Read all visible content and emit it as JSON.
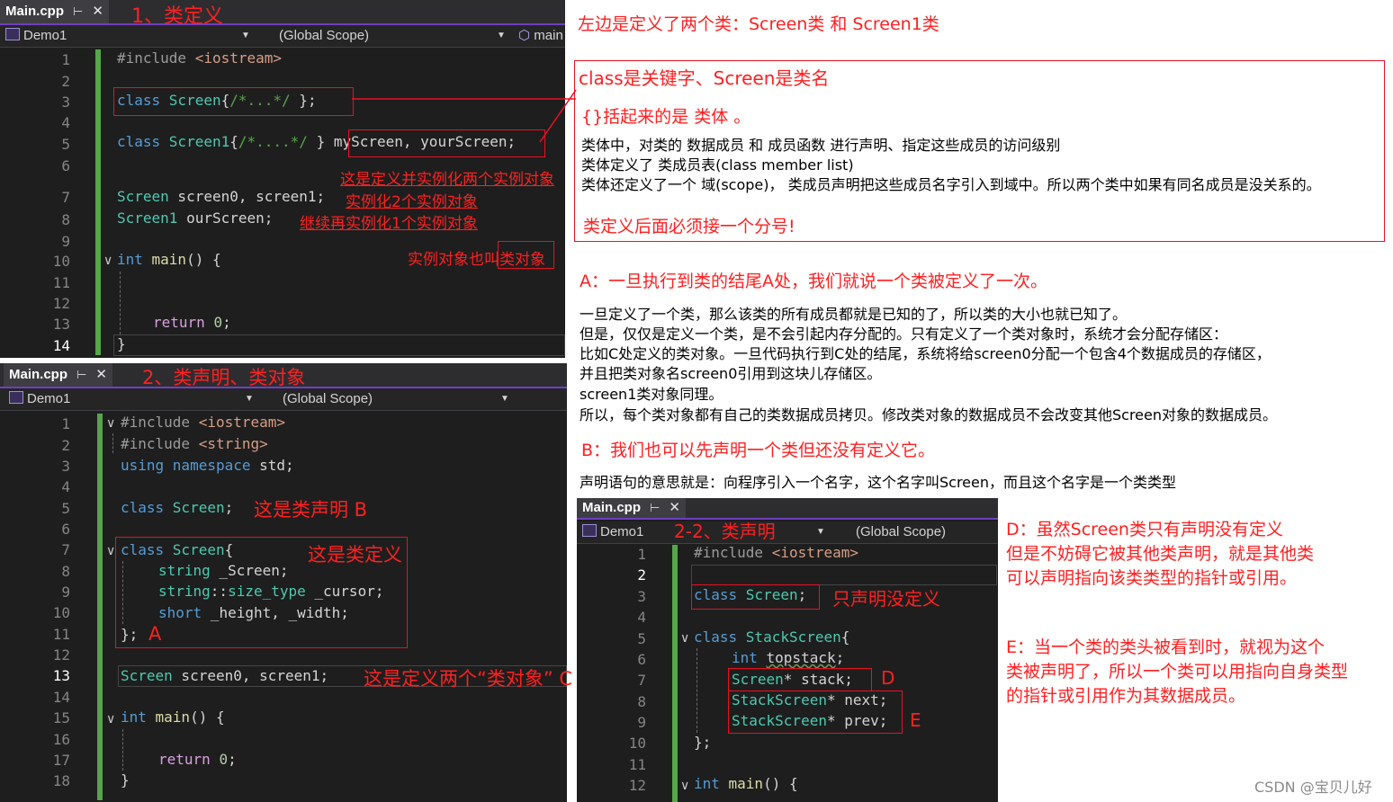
{
  "editor1": {
    "tab": "Main.cpp",
    "pin": "⊢",
    "close": "✕",
    "heading": "1、类定义",
    "project": "Demo1",
    "scope": "(Global Scope)",
    "member": "main",
    "lines": [
      "1",
      "2",
      "3",
      "4",
      "5",
      "6",
      "7",
      "8",
      "9",
      "10",
      "11",
      "12",
      "13",
      "14"
    ],
    "code": {
      "l1a": "#include ",
      "l1b": "<iostream>",
      "l3a": "class ",
      "l3b": "Screen",
      "l3c": "{",
      "l3d": "/*...*/",
      "l3e": " };",
      "l5a": "class ",
      "l5b": "Screen1",
      "l5c": "{",
      "l5d": "/*....*/",
      "l5e": " } ",
      "l5f": "myScreen, yourScreen",
      "l5g": ";",
      "l7a": "Screen",
      "l7b": " screen0, screen1;",
      "l8a": "Screen1",
      "l8b": " ourScreen;",
      "l10a": "int ",
      "l10b": "main",
      "l10c": "() {",
      "l13a": "return ",
      "l13b": "0",
      "l13c": ";",
      "l14": "}"
    },
    "notes": {
      "n5": "这是定义并实例化两个实例对象",
      "n7": "实例化2个实例对象",
      "n8": "继续再实例化1个实例对象",
      "n10": "实例对象也叫类对象"
    }
  },
  "editor2": {
    "tab": "Main.cpp",
    "pin": "⊢",
    "close": "✕",
    "heading": "2、类声明、类对象",
    "project": "Demo1",
    "scope": "(Global Scope)",
    "lines": [
      "1",
      "2",
      "3",
      "4",
      "5",
      "6",
      "7",
      "8",
      "9",
      "10",
      "11",
      "12",
      "13",
      "14",
      "15",
      "16",
      "17",
      "18"
    ],
    "code": {
      "l1a": "#include ",
      "l1b": "<iostream>",
      "l2a": "#include ",
      "l2b": "<string>",
      "l3a": "using namespace ",
      "l3b": "std;",
      "l5a": "class ",
      "l5b": "Screen",
      "l5c": ";",
      "l7a": "class ",
      "l7b": "Screen",
      "l7c": "{",
      "l8a": "string",
      "l8b": " _Screen;",
      "l9a": "string",
      "l9b": "::",
      "l9c": "size_type",
      "l9d": " _cursor;",
      "l10a": "short",
      "l10b": " _height, _width;",
      "l11": "};",
      "l13a": "Screen",
      "l13b": " screen0, screen1;",
      "l15a": "int ",
      "l15b": "main",
      "l15c": "() {",
      "l17a": "return ",
      "l17b": "0",
      "l17c": ";",
      "l18": "}"
    },
    "notes": {
      "n5": "这是类声明  B",
      "n7": "这是类定义",
      "n11": "A",
      "n13": "这是定义两个“类对象”  C"
    }
  },
  "editor3": {
    "tab": "Main.cpp",
    "pin": "⊢",
    "close": "✕",
    "heading": "2-2、类声明",
    "project": "Demo1",
    "scope": "(Global Scope)",
    "lines": [
      "1",
      "2",
      "3",
      "4",
      "5",
      "6",
      "7",
      "8",
      "9",
      "10",
      "11",
      "12"
    ],
    "code": {
      "l1a": "#include ",
      "l1b": "<iostream>",
      "l3a": "class ",
      "l3b": "Screen",
      "l3c": ";",
      "l5a": "class ",
      "l5b": "StackScreen",
      "l5c": "{",
      "l6a": "int ",
      "l6b": "topstack",
      "l6c": ";",
      "l7a": "Screen",
      "l7b": "* ",
      "l7c": "stack",
      "l7d": ";",
      "l8a": "StackScreen",
      "l8b": "* ",
      "l8c": "next",
      "l8d": ";",
      "l9a": "StackScreen",
      "l9b": "* ",
      "l9c": "prev",
      "l9d": ";",
      "l10": "};",
      "l12a": "int ",
      "l12b": "main",
      "l12c": "() {"
    },
    "notes": {
      "n3": "只声明没定义",
      "n7": "D",
      "n9": "E"
    }
  },
  "right": {
    "t0": "左边是定义了两个类：Screen类 和 Screen1类",
    "box1": {
      "t1": "class是关键字、Screen是类名",
      "t2": "{}括起来的是 类体 。",
      "t3": "类体中，对类的 数据成员 和 成员函数 进行声明、指定这些成员的访问级别",
      "t4": "类体定义了 类成员表(class member list)",
      "t5": "类体还定义了一个 域(scope)， 类成员声明把这些成员名字引入到域中。所以两个类中如果有同名成员是没关系的。",
      "t6": "类定义后面必须接一个分号!"
    },
    "a_title": "A：一旦执行到类的结尾A处，我们就说一个类被定义了一次。",
    "a_lines": [
      "一旦定义了一个类，那么该类的所有成员都就是已知的了，所以类的大小也就已知了。",
      "但是，仅仅是定义一个类，是不会引起内存分配的。只有定义了一个类对象时，系统才会分配存储区：",
      "比如C处定义的类对象。一旦代码执行到C处的结尾，系统将给screen0分配一个包含4个数据成员的存储区，",
      "并且把类对象名screen0引用到这块儿存储区。",
      "screen1类对象同理。",
      "所以，每个类对象都有自己的类数据成员拷贝。修改类对象的数据成员不会改变其他Screen对象的数据成员。"
    ],
    "b_title": "B：我们也可以先声明一个类但还没有定义它。",
    "b_line": "声明语句的意思就是：向程序引入一个名字，这个名字叫Screen，而且这个名字是一个类类型",
    "d_lines": [
      "D：虽然Screen类只有声明没有定义",
      "但是不妨碍它被其他类声明，就是其他类",
      "可以声明指向该类类型的指针或引用。"
    ],
    "e_lines": [
      "E：当一个类的类头被看到时，就视为这个",
      "类被声明了，所以一个类可以用指向自身类型",
      "的指针或引用作为其数据成员。"
    ],
    "watermark": "CSDN @宝贝儿好"
  },
  "colors": {
    "annotation_red": "#ff2020",
    "editor_bg": "#1e1e1e",
    "keyword": "#569cd6",
    "type": "#4ec9b0",
    "change_bar": "#57a64a"
  }
}
